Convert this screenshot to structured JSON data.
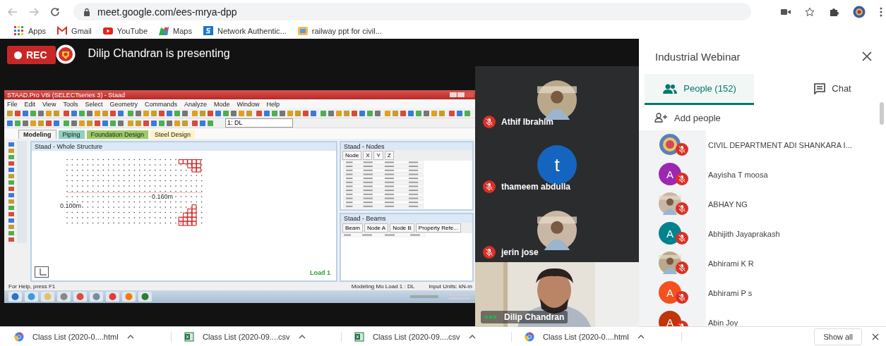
{
  "browser": {
    "url": "meet.google.com/ees-mrya-dpp",
    "bookmarks": [
      {
        "label": "Apps",
        "kind": "apps"
      },
      {
        "label": "Gmail",
        "kind": "gmail"
      },
      {
        "label": "YouTube",
        "kind": "youtube"
      },
      {
        "label": "Maps",
        "kind": "maps"
      },
      {
        "label": "Network Authentic...",
        "kind": "s"
      },
      {
        "label": "railway ppt for civil...",
        "kind": "doc"
      }
    ]
  },
  "meeting": {
    "recording": true,
    "rec_label": "REC",
    "presenting_text": "Dilip Chandran is presenting",
    "shared_screen": {
      "app_title": "STAAD.Pro V8i (SELECTseries 3) - Staad",
      "menu": [
        "File",
        "Edit",
        "View",
        "Tools",
        "Select",
        "Geometry",
        "Commands",
        "Analyze",
        "Mode",
        "Window",
        "Help"
      ],
      "load_combo": "1: DL",
      "tabs": [
        {
          "label": "Modeling",
          "selected": true,
          "color": "#f4f4f4"
        },
        {
          "label": "Piping",
          "selected": false,
          "color": "#8fd0c0"
        },
        {
          "label": "Foundation Design",
          "selected": false,
          "color": "#9ccc65"
        },
        {
          "label": "Steel Design",
          "selected": false,
          "color": "#fff3c4"
        }
      ],
      "view_title": "Staad - Whole Structure",
      "dim_left": "0.100m",
      "dim_mid": "0.160m",
      "load_label": "Load 1",
      "nodes_title": "Staad - Nodes",
      "nodes_columns": [
        "Node",
        "X",
        "Y",
        "Z"
      ],
      "beams_title": "Staad - Beams",
      "beams_columns": [
        "Beam",
        "Node A",
        "Node B",
        "Property Refe..."
      ],
      "status_help": "For Help, press F1",
      "status_mode": "Modeling Mo Load 1 : DL",
      "status_units": "Input Units: kN-m"
    },
    "tiles": [
      {
        "name": "Athif Ibrahim",
        "muted": true
      },
      {
        "name": "thameem abdulla",
        "kind": "letter",
        "letter": "t",
        "color": "#1565c0",
        "muted": true
      },
      {
        "name": "jerin jose",
        "muted": true
      }
    ],
    "presenter": {
      "name": "Dilip Chandran",
      "speaking": true
    }
  },
  "panel": {
    "title": "Industrial Webinar",
    "tabs": [
      {
        "label": "People (152)",
        "kind": "people",
        "selected": true
      },
      {
        "label": "Chat",
        "kind": "chat",
        "selected": false
      }
    ],
    "add_people": "Add people",
    "participants": [
      {
        "name": "CIVIL DEPARTMENT ADI SHANKARA I...",
        "kind": "emblem",
        "muted": true
      },
      {
        "name": "Aayisha T moosa",
        "kind": "letter",
        "letter": "A",
        "color": "#9c27b0",
        "muted": true
      },
      {
        "name": "ABHAY NG",
        "muted": true
      },
      {
        "name": "Abhijith Jayaprakash",
        "kind": "letter",
        "letter": "A",
        "color": "#00838f",
        "muted": true
      },
      {
        "name": "Abhirami K R",
        "muted": true
      },
      {
        "name": "Abhirami P s",
        "kind": "letter",
        "letter": "A",
        "color": "#f4511e",
        "muted": true
      },
      {
        "name": "Abin Joy",
        "kind": "letter",
        "letter": "A",
        "color": "#bf360c",
        "muted": true
      }
    ]
  },
  "downloads": {
    "items": [
      {
        "name": "Class List (2020-0....html",
        "kind": "html"
      },
      {
        "name": "Class List (2020-09....csv",
        "kind": "csv"
      },
      {
        "name": "Class List (2020-09....csv",
        "kind": "csv"
      },
      {
        "name": "Class List (2020-0....html",
        "kind": "html"
      }
    ],
    "show_all": "Show all"
  }
}
